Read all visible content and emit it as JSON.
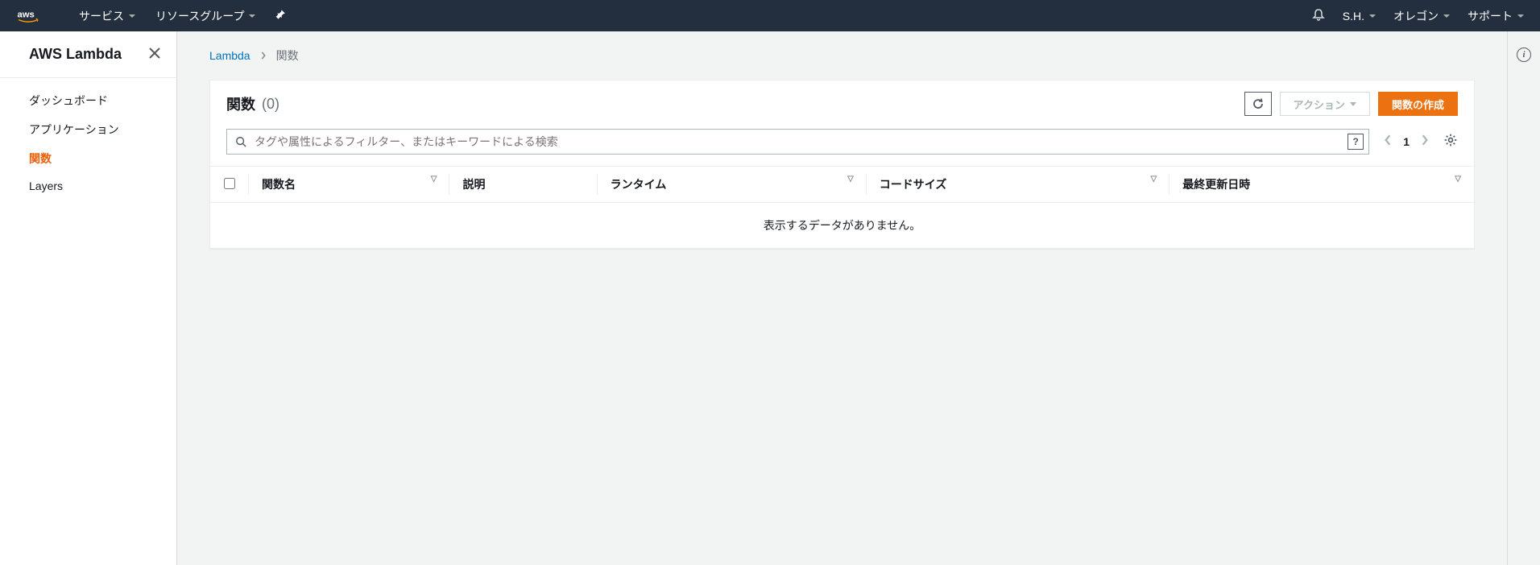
{
  "topnav": {
    "services": "サービス",
    "resource_groups": "リソースグループ",
    "user": "S.H.",
    "region": "オレゴン",
    "support": "サポート"
  },
  "sidebar": {
    "title": "AWS Lambda",
    "items": [
      {
        "label": "ダッシュボード",
        "active": false
      },
      {
        "label": "アプリケーション",
        "active": false
      },
      {
        "label": "関数",
        "active": true
      },
      {
        "label": "Layers",
        "active": false
      }
    ]
  },
  "breadcrumb": {
    "root": "Lambda",
    "current": "関数"
  },
  "panel": {
    "title": "関数",
    "count": "(0)",
    "actions_label": "アクション",
    "create_label": "関数の作成",
    "search_placeholder": "タグや属性によるフィルター、またはキーワードによる検索",
    "page": "1"
  },
  "table": {
    "columns": [
      "関数名",
      "説明",
      "ランタイム",
      "コードサイズ",
      "最終更新日時"
    ],
    "empty_message": "表示するデータがありません。"
  }
}
